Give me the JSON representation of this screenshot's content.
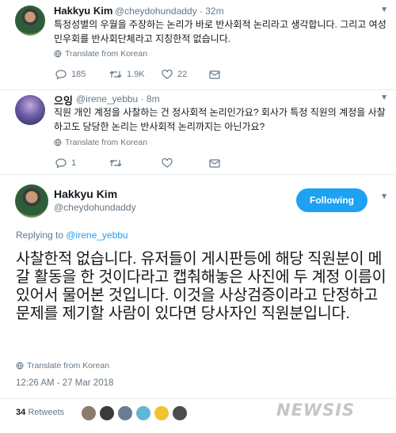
{
  "tweet1": {
    "name": "Hakkyu Kim",
    "handle_time": "@cheydohundaddy · 32m",
    "text": "특정성별의 우월을 주장하는 논리가 바로 반사회적 논리라고 생각합니다. 그리고 여성민우회를 반사회단체라고 지칭한적 없습니다.",
    "translate": "Translate from Korean",
    "reply_count": "185",
    "retweet_count": "1.9K",
    "like_count": "22"
  },
  "tweet2": {
    "name": "으잉",
    "handle_time": "@irene_yebbu · 8m",
    "text": "직원 개인 계정을 사찰하는 건 정사회적 논리인가요? 회사가 특정 직원의 계정을 사찰하고도 당당한 논리는 반사회적 논리까지는 아닌가요?",
    "translate": "Translate from Korean",
    "reply_count": "1",
    "retweet_count": "",
    "like_count": ""
  },
  "main": {
    "name": "Hakkyu Kim",
    "handle": "@cheydohundaddy",
    "follow_label": "Following",
    "replying_prefix": "Replying to ",
    "replying_handle": "@irene_yebbu",
    "text": "사찰한적 없습니다. 유저들이 게시판등에 해당 직원분이 메갈 활동을 한 것이다라고 캡춰해놓은 사진에 두 계정 이름이 있어서 물어본 것입니다. 이것을 사상검증이라고 단정하고 문제를 제기할 사람이 있다면 당사자인 직원분입니다.",
    "translate": "Translate from Korean",
    "timestamp": "12:26 AM - 27 Mar 2018",
    "retweets_count": "34",
    "retweets_label": "Retweets"
  },
  "retweeter_colors": [
    "#8c7a6b",
    "#3a3a3a",
    "#6b7c94",
    "#5fb6d6",
    "#f2c230",
    "#4d4d4d"
  ],
  "watermark": "NEWSIS",
  "colors": {
    "accent": "#1da1f2",
    "muted": "#657786",
    "divider": "#e6ecf0"
  }
}
